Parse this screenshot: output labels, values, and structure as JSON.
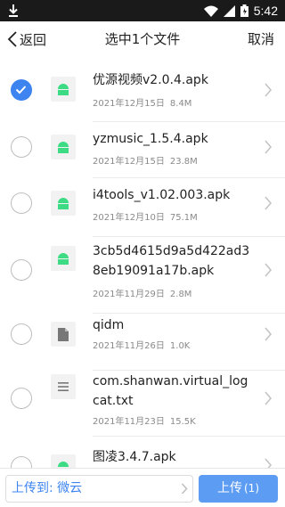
{
  "status_bar": {
    "time": "5:42",
    "icons": [
      "download-icon",
      "wifi-icon",
      "signal-icon",
      "battery-icon"
    ]
  },
  "top_bar": {
    "back_label": "返回",
    "title": "选中1个文件",
    "cancel_label": "取消"
  },
  "files": [
    {
      "name": "优源视频v2.0.4.apk",
      "date": "2021年12月15日",
      "size": "8.4M",
      "icon": "apk-icon",
      "selected": true
    },
    {
      "name": "yzmusic_1.5.4.apk",
      "date": "2021年12月15日",
      "size": "23.8M",
      "icon": "apk-icon",
      "selected": false
    },
    {
      "name": "i4tools_v1.02.003.apk",
      "date": "2021年12月10日",
      "size": "75.1M",
      "icon": "apk-icon",
      "selected": false
    },
    {
      "name": "3cb5d4615d9a5d422ad38eb19091a17b.apk",
      "date": "2021年11月29日",
      "size": "2.8M",
      "icon": "apk-icon",
      "selected": false
    },
    {
      "name": "qidm",
      "date": "2021年11月26日",
      "size": "1.0K",
      "icon": "file-icon",
      "selected": false
    },
    {
      "name": "com.shanwan.virtual_logcat.txt",
      "date": "2021年11月23日",
      "size": "15.5K",
      "icon": "text-file-icon",
      "selected": false
    },
    {
      "name": "图凌3.4.7.apk",
      "date": "",
      "size": "",
      "icon": "apk-icon",
      "selected": false
    }
  ],
  "bottom_bar": {
    "destination_label": "上传到: 微云",
    "upload_label": "上传",
    "upload_count": "(1)"
  },
  "colors": {
    "accent": "#3d84f0",
    "upload_button": "#5c9cf3",
    "android_green": "#3ddc84",
    "status_bar": "#1a1a1a"
  }
}
